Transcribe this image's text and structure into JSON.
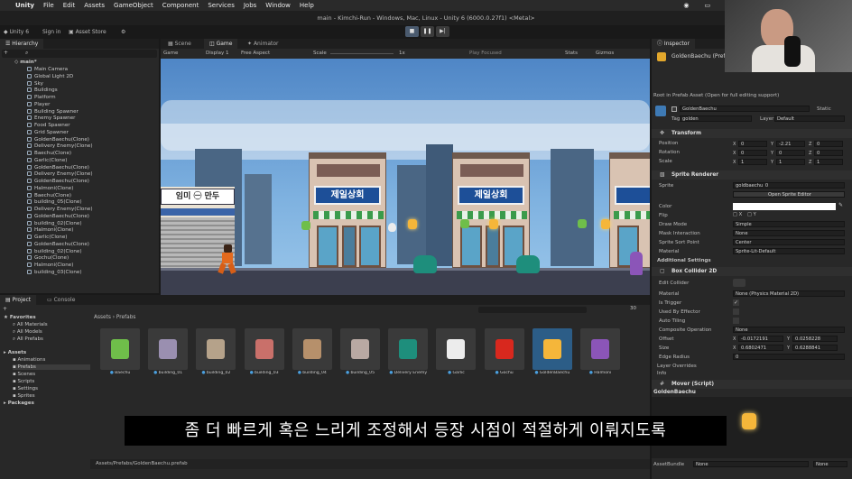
{
  "menubar": {
    "app": "Unity",
    "items": [
      "File",
      "Edit",
      "Assets",
      "GameObject",
      "Component",
      "Services",
      "Jobs",
      "Window",
      "Help"
    ],
    "status_letter": "A"
  },
  "titlebar": {
    "title": "main - Kimchi-Run - Windows, Mac, Linux - Unity 6 (6000.0.27f1) <Metal>"
  },
  "toolbar": {
    "account": "Unity 6",
    "sign_in": "Sign in",
    "asset_store": "Asset Store"
  },
  "hierarchy": {
    "tab": "Hierarchy",
    "root": "main*",
    "items": [
      "Main Camera",
      "Global Light 2D",
      "Sky",
      "Buildings",
      "Platform",
      "Player",
      "Building Spawner",
      "Enemy Spawner",
      "Food Spawner",
      "Grid Spawner",
      "GoldenBaechu(Clone)",
      "Delivery Enemy(Clone)",
      "Baechu(Clone)",
      "Garlic(Clone)",
      "GoldenBaechu(Clone)",
      "Delivery Enemy(Clone)",
      "GoldenBaechu(Clone)",
      "Halmoni(Clone)",
      "Baechu(Clone)",
      "building_05(Clone)",
      "Delivery Enemy(Clone)",
      "GoldenBaechu(Clone)",
      "building_02(Clone)",
      "Halmoni(Clone)",
      "Garlic(Clone)",
      "GoldenBaechu(Clone)",
      "building_02(Clone)",
      "Gochu(Clone)",
      "Halmoni(Clone)",
      "building_03(Clone)"
    ]
  },
  "game_view": {
    "tabs": [
      "Scene",
      "Game",
      "Animator"
    ],
    "active_tab": "Game",
    "mode": "Game",
    "display": "Display 1",
    "aspect": "Free Aspect",
    "scale_label": "Scale",
    "scale_value": "1x",
    "play_focused": "Play Focused",
    "stats": "Stats",
    "gizmos": "Gizmos",
    "signs": [
      "제일상회",
      "제일상회"
    ],
    "left_sign": "임미 ㊀ 만두"
  },
  "inspector": {
    "tab": "Inspector",
    "asset_name": "GoldenBaechu (Prefab Asset)",
    "root_note": "Root in Prefab Asset (Open for full editing support)",
    "object_name": "GoldenBaechu",
    "static_label": "Static",
    "tag_label": "Tag",
    "tag_value": "golden",
    "layer_label": "Layer",
    "layer_value": "Default",
    "transform": {
      "title": "Transform",
      "rows": [
        {
          "label": "Position",
          "x": "0",
          "y": "-2.21",
          "z": "0"
        },
        {
          "label": "Rotation",
          "x": "0",
          "y": "0",
          "z": "0"
        },
        {
          "label": "Scale",
          "x": "1",
          "y": "1",
          "z": "1"
        }
      ]
    },
    "sprite_renderer": {
      "title": "Sprite Renderer",
      "sprite_label": "Sprite",
      "sprite_value": "goldbaechu_0",
      "open_editor": "Open Sprite Editor",
      "color_label": "Color",
      "flip_label": "Flip",
      "flip_x": "X",
      "flip_y": "Y",
      "draw_mode_label": "Draw Mode",
      "draw_mode_value": "Simple",
      "mask_label": "Mask Interaction",
      "mask_value": "None",
      "sort_point_label": "Sprite Sort Point",
      "sort_point_value": "Center",
      "material_label": "Material",
      "material_value": "Sprite-Lit-Default",
      "additional": "Additional Settings"
    },
    "box_collider": {
      "title": "Box Collider 2D",
      "edit_collider": "Edit Collider",
      "material_label": "Material",
      "material_value": "None (Physics Material 2D)",
      "trigger_label": "Is Trigger",
      "effector_label": "Used By Effector",
      "tiling_label": "Auto Tiling",
      "composite_label": "Composite Operation",
      "composite_value": "None",
      "offset_label": "Offset",
      "offset_x": "-0.0172191",
      "offset_y": "0.0258228",
      "size_label": "Size",
      "size_x": "0.6802471",
      "size_y": "0.6288841",
      "edge_label": "Edge Radius",
      "edge_value": "0",
      "overrides": "Layer Overrides",
      "info": "Info"
    },
    "mover": {
      "title": "Mover (Script)"
    },
    "preview_name": "GoldenBaechu",
    "assetbundle_label": "AssetBundle",
    "assetbundle_value": "None",
    "assetbundle_variant": "None"
  },
  "project": {
    "tabs": [
      "Project",
      "Console"
    ],
    "favorites": "Favorites",
    "fav_items": [
      "All Materials",
      "All Models",
      "All Prefabs"
    ],
    "assets": "Assets",
    "asset_folders": [
      "Animations",
      "Prefabs",
      "Scenes",
      "Scripts",
      "Settings",
      "Sprites"
    ],
    "packages": "Packages",
    "breadcrumb": [
      "Assets",
      "Prefabs"
    ],
    "count": "30",
    "prefabs": [
      "Baechu",
      "building_01",
      "building_02",
      "building_03",
      "building_04",
      "building_05",
      "Delivery Enemy",
      "Garlic",
      "Gochu",
      "GoldenBaechu",
      "Halmoni"
    ],
    "footer_path": "Assets/Prefabs/GoldenBaechu.prefab"
  },
  "subtitle": "좀 더 빠르게 혹은 느리게 조정해서 등장 시점이 적절하게 이뤄지도록",
  "colors": {
    "sky_top": "#4f86c6",
    "sky_bottom": "#7fb2e0",
    "selection": "#2c5d87",
    "sign_blue": "#1d4f98"
  }
}
